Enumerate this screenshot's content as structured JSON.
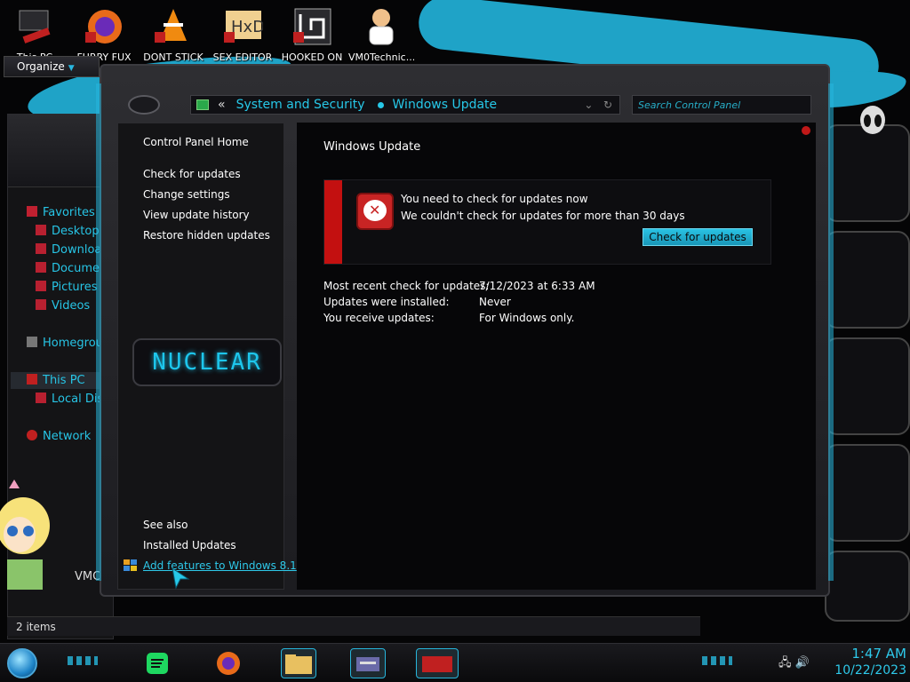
{
  "desktop": {
    "icons": [
      {
        "label": "This PC",
        "icon": "computer-icon"
      },
      {
        "label": "FURRY FUX",
        "icon": "firefox-icon"
      },
      {
        "label": "DONT STICK",
        "icon": "vlc-icon"
      },
      {
        "label": "SEX EDITOR",
        "icon": "hxd-icon"
      },
      {
        "label": "HOOKED ON",
        "icon": "app-icon"
      },
      {
        "label": "VM0Technic...",
        "icon": "user-doctor-icon"
      }
    ]
  },
  "explorer": {
    "organize_label": "Organize",
    "nav": [
      {
        "label": "Favorites"
      },
      {
        "label": "Desktop"
      },
      {
        "label": "Downloads"
      },
      {
        "label": "Documents"
      },
      {
        "label": "Pictures"
      },
      {
        "label": "Videos"
      },
      {
        "label": "Homegroup"
      },
      {
        "label": "This PC"
      },
      {
        "label": "Local Disk"
      },
      {
        "label": "Network"
      }
    ],
    "status": "2 items",
    "partial_label": "VMC"
  },
  "window": {
    "breadcrumb": {
      "back": "«",
      "items": [
        "System and Security",
        "Windows Update"
      ]
    },
    "search_placeholder": "Search Control Panel",
    "left_pane": {
      "home": "Control Panel Home",
      "links": [
        "Check for updates",
        "Change settings",
        "View update history",
        "Restore hidden updates"
      ],
      "logo_text": "NUCLEAR",
      "see_also": "See also",
      "installed_updates": "Installed Updates",
      "add_features": "Add features to Windows 8.1"
    },
    "content": {
      "title": "Windows Update",
      "alert": {
        "line1": "You need to check for updates now",
        "line2": "We couldn't check for updates for more than 30 days",
        "button": "Check for updates"
      },
      "info": [
        {
          "key": "Most recent check for updates:",
          "value": "7/12/2023 at 6:33 AM"
        },
        {
          "key": "Updates were installed:",
          "value": "Never"
        },
        {
          "key": "You receive updates:",
          "value": "For Windows only."
        }
      ]
    }
  },
  "taskbar": {
    "apps": [
      "spotify-icon",
      "firefox-icon",
      "file-explorer-icon",
      "control-panel-icon",
      "media-icon"
    ],
    "time": "1:47 AM",
    "date": "10/22/2023"
  },
  "colors": {
    "accent": "#27c8e8",
    "alert_red": "#c31010",
    "button": "#29c2e3"
  }
}
